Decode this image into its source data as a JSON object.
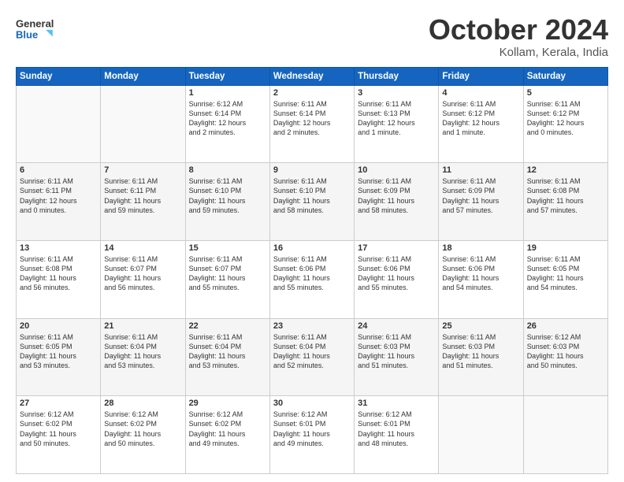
{
  "header": {
    "logo_line1": "General",
    "logo_line2": "Blue",
    "month": "October 2024",
    "location": "Kollam, Kerala, India"
  },
  "days_of_week": [
    "Sunday",
    "Monday",
    "Tuesday",
    "Wednesday",
    "Thursday",
    "Friday",
    "Saturday"
  ],
  "weeks": [
    [
      {
        "day": "",
        "detail": ""
      },
      {
        "day": "",
        "detail": ""
      },
      {
        "day": "1",
        "detail": "Sunrise: 6:12 AM\nSunset: 6:14 PM\nDaylight: 12 hours\nand 2 minutes."
      },
      {
        "day": "2",
        "detail": "Sunrise: 6:11 AM\nSunset: 6:14 PM\nDaylight: 12 hours\nand 2 minutes."
      },
      {
        "day": "3",
        "detail": "Sunrise: 6:11 AM\nSunset: 6:13 PM\nDaylight: 12 hours\nand 1 minute."
      },
      {
        "day": "4",
        "detail": "Sunrise: 6:11 AM\nSunset: 6:12 PM\nDaylight: 12 hours\nand 1 minute."
      },
      {
        "day": "5",
        "detail": "Sunrise: 6:11 AM\nSunset: 6:12 PM\nDaylight: 12 hours\nand 0 minutes."
      }
    ],
    [
      {
        "day": "6",
        "detail": "Sunrise: 6:11 AM\nSunset: 6:11 PM\nDaylight: 12 hours\nand 0 minutes."
      },
      {
        "day": "7",
        "detail": "Sunrise: 6:11 AM\nSunset: 6:11 PM\nDaylight: 11 hours\nand 59 minutes."
      },
      {
        "day": "8",
        "detail": "Sunrise: 6:11 AM\nSunset: 6:10 PM\nDaylight: 11 hours\nand 59 minutes."
      },
      {
        "day": "9",
        "detail": "Sunrise: 6:11 AM\nSunset: 6:10 PM\nDaylight: 11 hours\nand 58 minutes."
      },
      {
        "day": "10",
        "detail": "Sunrise: 6:11 AM\nSunset: 6:09 PM\nDaylight: 11 hours\nand 58 minutes."
      },
      {
        "day": "11",
        "detail": "Sunrise: 6:11 AM\nSunset: 6:09 PM\nDaylight: 11 hours\nand 57 minutes."
      },
      {
        "day": "12",
        "detail": "Sunrise: 6:11 AM\nSunset: 6:08 PM\nDaylight: 11 hours\nand 57 minutes."
      }
    ],
    [
      {
        "day": "13",
        "detail": "Sunrise: 6:11 AM\nSunset: 6:08 PM\nDaylight: 11 hours\nand 56 minutes."
      },
      {
        "day": "14",
        "detail": "Sunrise: 6:11 AM\nSunset: 6:07 PM\nDaylight: 11 hours\nand 56 minutes."
      },
      {
        "day": "15",
        "detail": "Sunrise: 6:11 AM\nSunset: 6:07 PM\nDaylight: 11 hours\nand 55 minutes."
      },
      {
        "day": "16",
        "detail": "Sunrise: 6:11 AM\nSunset: 6:06 PM\nDaylight: 11 hours\nand 55 minutes."
      },
      {
        "day": "17",
        "detail": "Sunrise: 6:11 AM\nSunset: 6:06 PM\nDaylight: 11 hours\nand 55 minutes."
      },
      {
        "day": "18",
        "detail": "Sunrise: 6:11 AM\nSunset: 6:06 PM\nDaylight: 11 hours\nand 54 minutes."
      },
      {
        "day": "19",
        "detail": "Sunrise: 6:11 AM\nSunset: 6:05 PM\nDaylight: 11 hours\nand 54 minutes."
      }
    ],
    [
      {
        "day": "20",
        "detail": "Sunrise: 6:11 AM\nSunset: 6:05 PM\nDaylight: 11 hours\nand 53 minutes."
      },
      {
        "day": "21",
        "detail": "Sunrise: 6:11 AM\nSunset: 6:04 PM\nDaylight: 11 hours\nand 53 minutes."
      },
      {
        "day": "22",
        "detail": "Sunrise: 6:11 AM\nSunset: 6:04 PM\nDaylight: 11 hours\nand 53 minutes."
      },
      {
        "day": "23",
        "detail": "Sunrise: 6:11 AM\nSunset: 6:04 PM\nDaylight: 11 hours\nand 52 minutes."
      },
      {
        "day": "24",
        "detail": "Sunrise: 6:11 AM\nSunset: 6:03 PM\nDaylight: 11 hours\nand 51 minutes."
      },
      {
        "day": "25",
        "detail": "Sunrise: 6:11 AM\nSunset: 6:03 PM\nDaylight: 11 hours\nand 51 minutes."
      },
      {
        "day": "26",
        "detail": "Sunrise: 6:12 AM\nSunset: 6:03 PM\nDaylight: 11 hours\nand 50 minutes."
      }
    ],
    [
      {
        "day": "27",
        "detail": "Sunrise: 6:12 AM\nSunset: 6:02 PM\nDaylight: 11 hours\nand 50 minutes."
      },
      {
        "day": "28",
        "detail": "Sunrise: 6:12 AM\nSunset: 6:02 PM\nDaylight: 11 hours\nand 50 minutes."
      },
      {
        "day": "29",
        "detail": "Sunrise: 6:12 AM\nSunset: 6:02 PM\nDaylight: 11 hours\nand 49 minutes."
      },
      {
        "day": "30",
        "detail": "Sunrise: 6:12 AM\nSunset: 6:01 PM\nDaylight: 11 hours\nand 49 minutes."
      },
      {
        "day": "31",
        "detail": "Sunrise: 6:12 AM\nSunset: 6:01 PM\nDaylight: 11 hours\nand 48 minutes."
      },
      {
        "day": "",
        "detail": ""
      },
      {
        "day": "",
        "detail": ""
      }
    ]
  ]
}
